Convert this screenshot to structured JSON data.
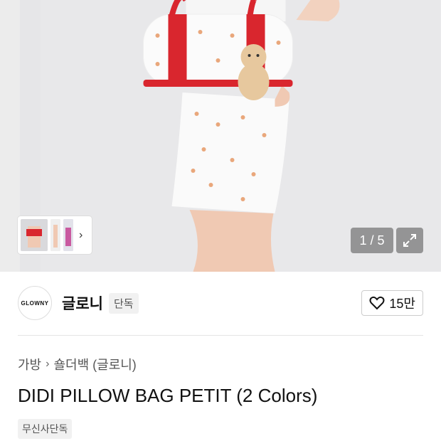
{
  "gallery": {
    "counter": "1 / 5",
    "next_thumb_icon": "chevron-right-icon",
    "expand_icon": "expand-icon",
    "colors": {
      "background": "#ececec",
      "bag_strap": "#d9262e"
    }
  },
  "brand": {
    "logo_text": "GLOWNY",
    "name": "글로니",
    "badge": "단독"
  },
  "like": {
    "icon": "heart-icon",
    "count": "15만"
  },
  "breadcrumb": {
    "items": [
      "가방",
      "숄더백 (글로니)"
    ]
  },
  "product": {
    "title": "DIDI PILLOW BAG PETIT (2 Colors)",
    "tag": "무신사단독"
  }
}
